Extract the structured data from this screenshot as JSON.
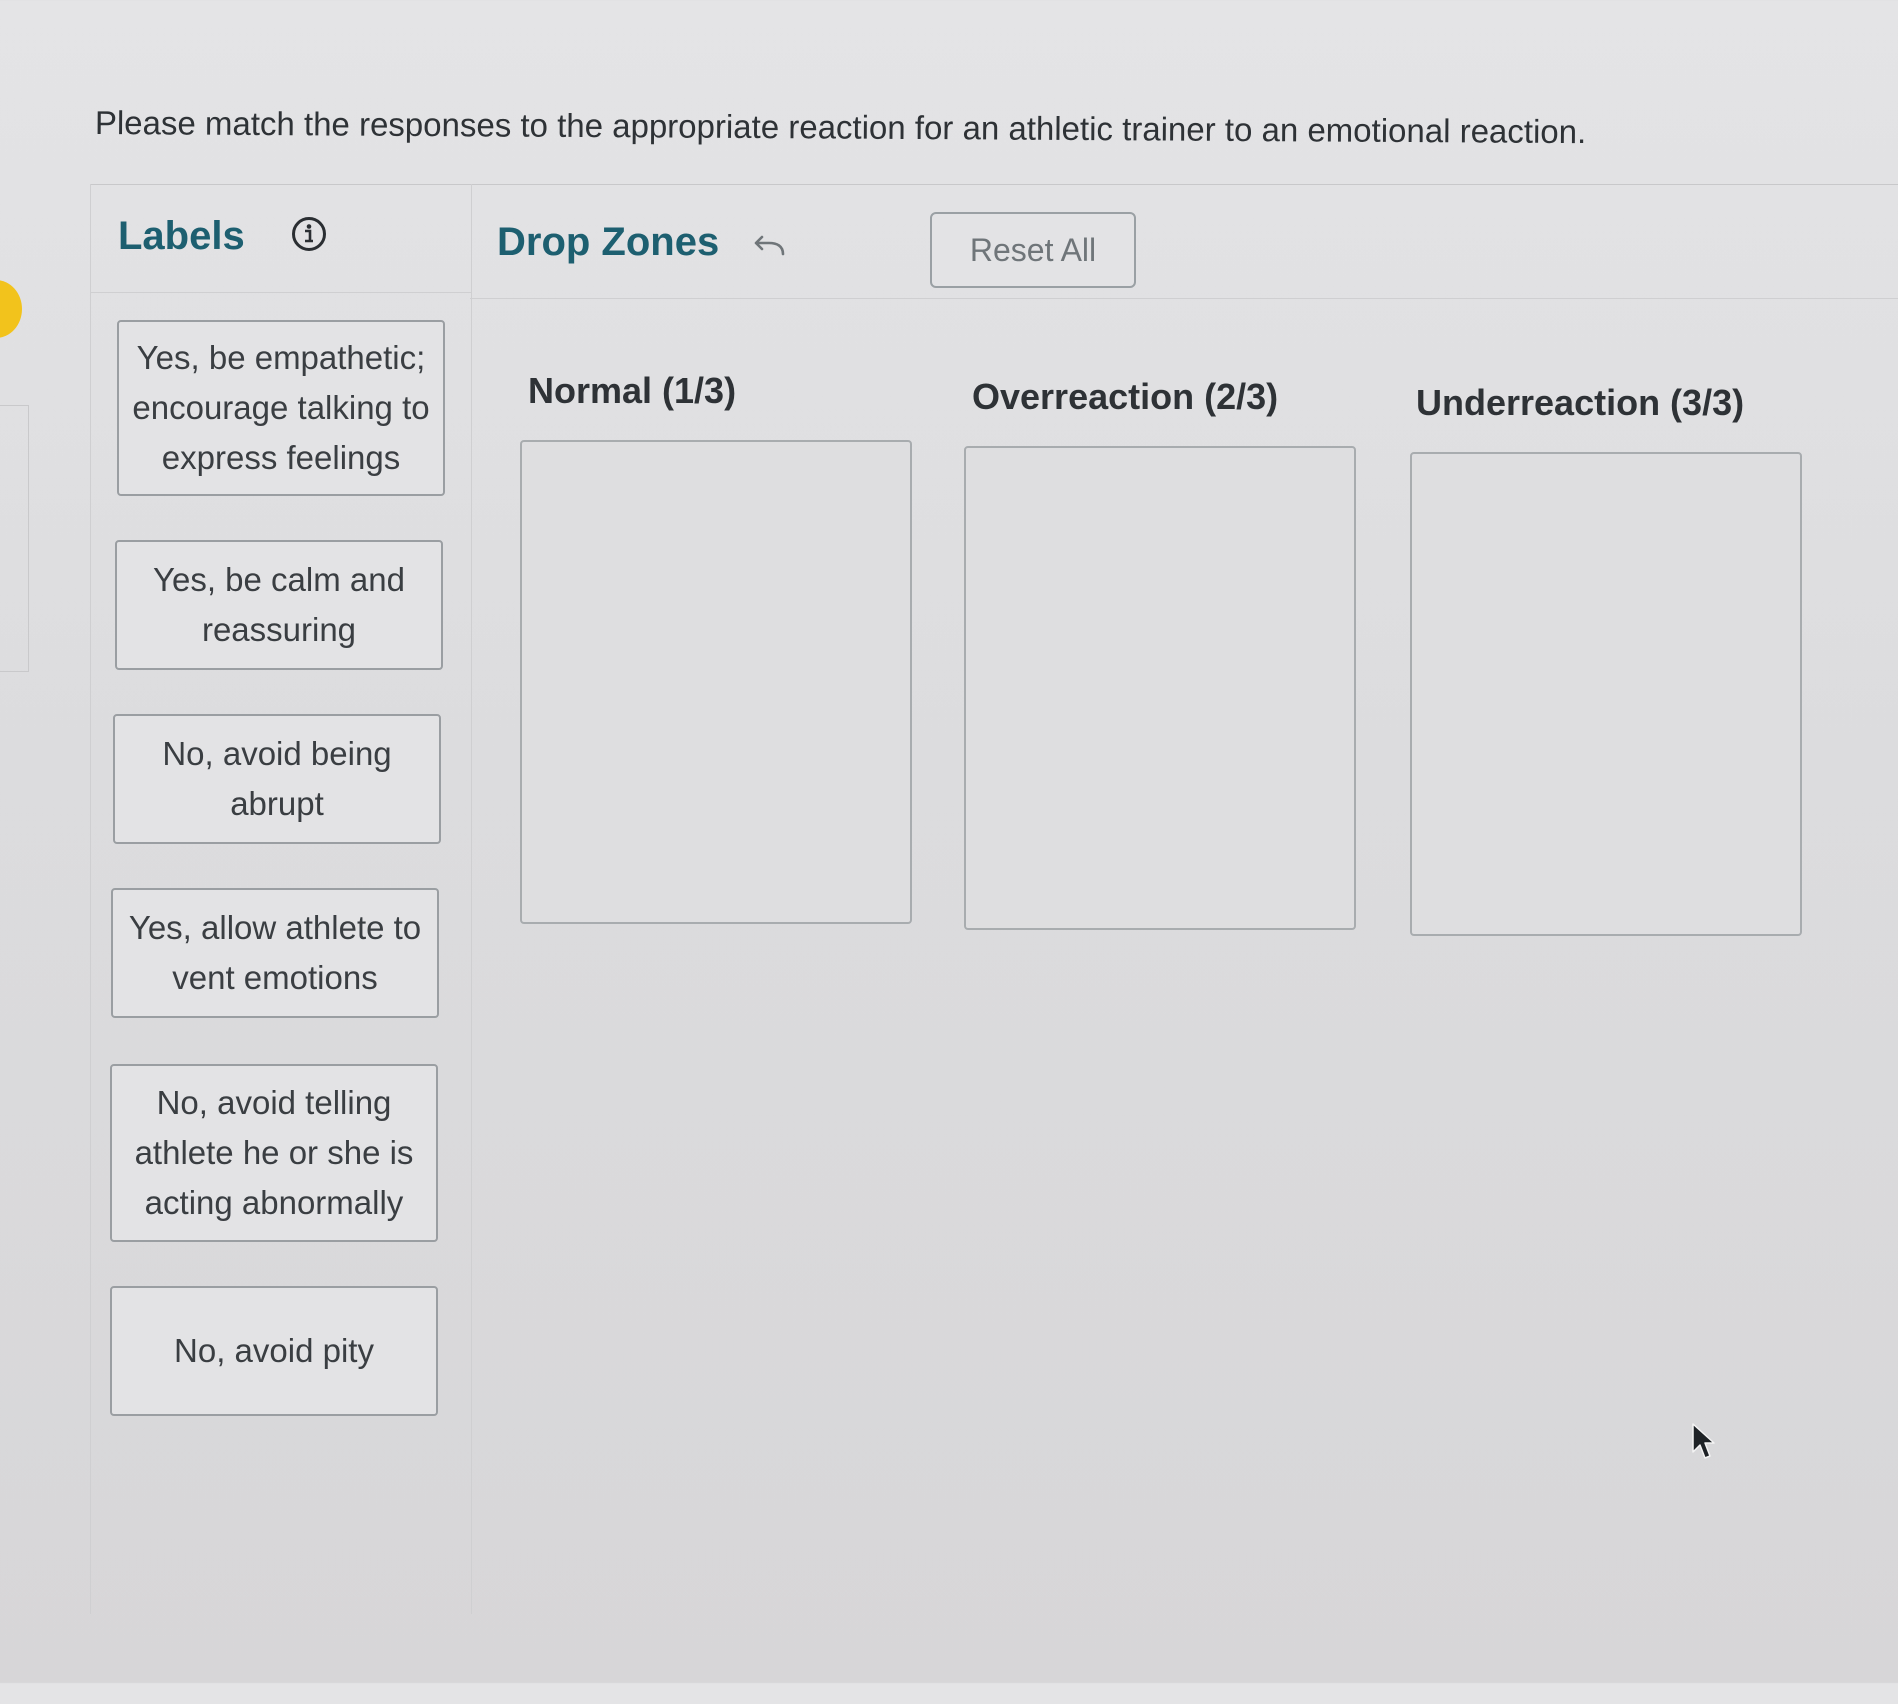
{
  "instruction": "Please match the responses to the appropriate reaction for an athletic trainer to an emotional reaction.",
  "labels_panel": {
    "title": "Labels",
    "info_icon": "info-circle-icon",
    "items": [
      {
        "text": "Yes, be empathetic; encourage talking to express feelings"
      },
      {
        "text": "Yes, be calm and reassuring"
      },
      {
        "text": "No, avoid being abrupt"
      },
      {
        "text": "Yes, allow athlete to vent emotions"
      },
      {
        "text": "No, avoid telling athlete he or she is acting abnormally"
      },
      {
        "text": "No, avoid pity"
      }
    ]
  },
  "drop_panel": {
    "title": "Drop Zones",
    "undo_icon": "undo-arrow-icon",
    "reset_label": "Reset All",
    "zones": [
      {
        "title": "Normal (1/3)"
      },
      {
        "title": "Overreaction (2/3)"
      },
      {
        "title": "Underreaction (3/3)"
      }
    ]
  },
  "colors": {
    "heading": "#1d5f70",
    "accent_dot": "#f2c31c"
  }
}
